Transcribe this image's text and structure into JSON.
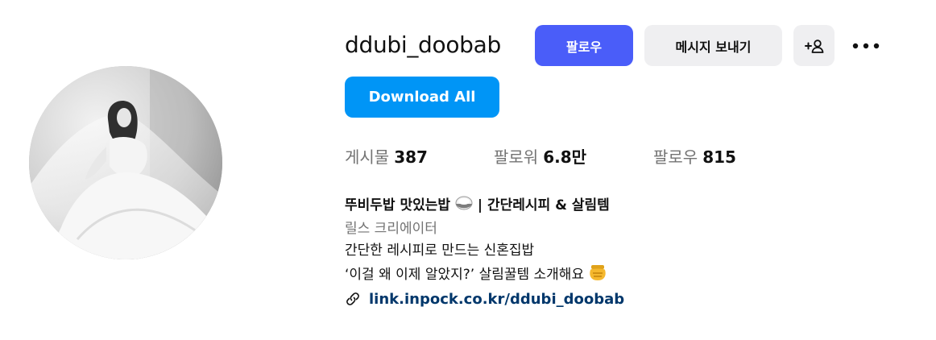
{
  "profile": {
    "username": "ddubi_doobab",
    "follow_label": "팔로우",
    "message_label": "메시지 보내기",
    "download_label": "Download All"
  },
  "stats": {
    "posts_label": "게시물",
    "posts_value": "387",
    "followers_label": "팔로워",
    "followers_value": "6.8만",
    "following_label": "팔로우",
    "following_value": "815"
  },
  "bio": {
    "name_before_emoji": "뚜비두밥 맛있는밥",
    "name_after_emoji": " | 간단레시피 & 살림템",
    "category": "릴스 크리에이터",
    "line1": "간단한 레시피로 만드는 신혼집밥",
    "line2": "‘이걸 왜 이제 알았지?’ 살림꿀템 소개해요",
    "link_text": "link.inpock.co.kr/ddubi_doobab"
  },
  "icons": {
    "rice_bowl": "rice-bowl-emoji",
    "honey_pot": "honey-pot-emoji",
    "add_user": "add-user-icon",
    "more": "more-dots-icon",
    "link": "link-icon"
  },
  "colors": {
    "follow_button": "#4a5df9",
    "download_button": "#0095f6",
    "secondary_button": "#efeff1",
    "link": "#00376b",
    "muted_text": "#737373"
  }
}
